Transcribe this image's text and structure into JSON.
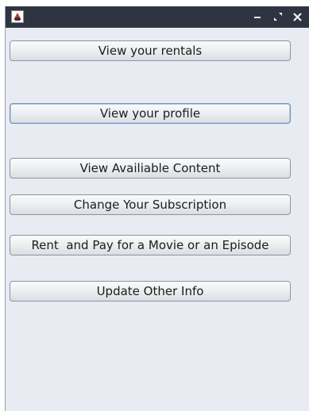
{
  "window": {
    "controls": {
      "minimize_icon": "minimize-icon",
      "maximize_icon": "maximize-icon",
      "close_icon": "close-icon"
    }
  },
  "menu": {
    "buttons": [
      {
        "label": "View your rentals"
      },
      {
        "label": "View your profile"
      },
      {
        "label": "View Availiable Content"
      },
      {
        "label": "Change Your Subscription"
      },
      {
        "label": "Rent  and Pay for a Movie or an Episode"
      },
      {
        "label": "Update Other Info"
      }
    ]
  },
  "colors": {
    "titlebar": "#2f3441",
    "window_bg": "#e8ebf1",
    "focus_border": "#6f8fb8"
  }
}
